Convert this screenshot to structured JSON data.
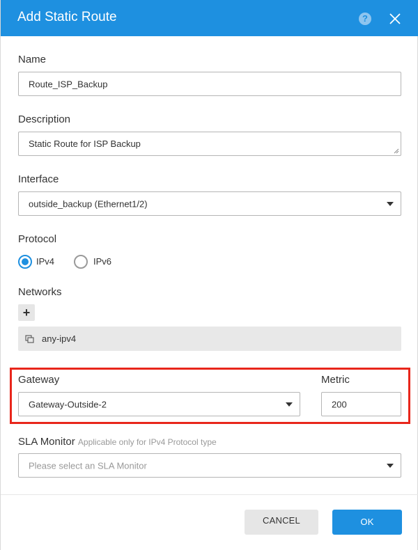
{
  "dialog": {
    "title": "Add Static Route"
  },
  "form": {
    "name": {
      "label": "Name",
      "value": "Route_ISP_Backup"
    },
    "description": {
      "label": "Description",
      "value": "Static Route for ISP Backup"
    },
    "interface": {
      "label": "Interface",
      "value": "outside_backup (Ethernet1/2)"
    },
    "protocol": {
      "label": "Protocol",
      "options": [
        {
          "label": "IPv4",
          "selected": true
        },
        {
          "label": "IPv6",
          "selected": false
        }
      ]
    },
    "networks": {
      "label": "Networks",
      "items": [
        {
          "label": "any-ipv4"
        }
      ]
    },
    "gateway": {
      "label": "Gateway",
      "value": "Gateway-Outside-2"
    },
    "metric": {
      "label": "Metric",
      "value": "200"
    },
    "sla_monitor": {
      "label": "SLA Monitor",
      "hint": "Applicable only for IPv4 Protocol type",
      "placeholder": "Please select an SLA Monitor"
    }
  },
  "footer": {
    "cancel_label": "CANCEL",
    "ok_label": "OK"
  },
  "colors": {
    "accent": "#1e90e0",
    "highlight_border": "#e8261b"
  },
  "icons": {
    "help": "help-icon",
    "close": "close-icon",
    "add": "plus-icon",
    "network": "network-object-icon",
    "dropdown": "caret-down-icon"
  }
}
